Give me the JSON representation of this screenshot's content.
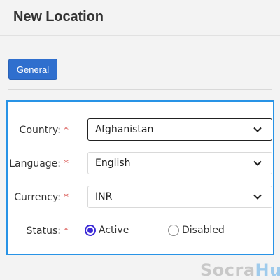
{
  "header": {
    "title": "New Location"
  },
  "tabs": [
    {
      "label": "General"
    }
  ],
  "form": {
    "country": {
      "label": "Country:",
      "required_mark": "*",
      "value": "Afghanistan"
    },
    "language": {
      "label": "Language:",
      "required_mark": "*",
      "value": "English"
    },
    "currency": {
      "label": "Currency:",
      "required_mark": "*",
      "value": "INR"
    },
    "status": {
      "label": "Status:",
      "required_mark": "*",
      "options": [
        {
          "label": "Active",
          "checked": true
        },
        {
          "label": "Disabled",
          "checked": false
        }
      ]
    }
  },
  "watermark": {
    "part1": "Socra",
    "part2": "Hub"
  },
  "colors": {
    "primary": "#2f6fce",
    "panel_border": "#2893e6",
    "required": "#d9534f",
    "radio_checked": "#3b29d6"
  }
}
